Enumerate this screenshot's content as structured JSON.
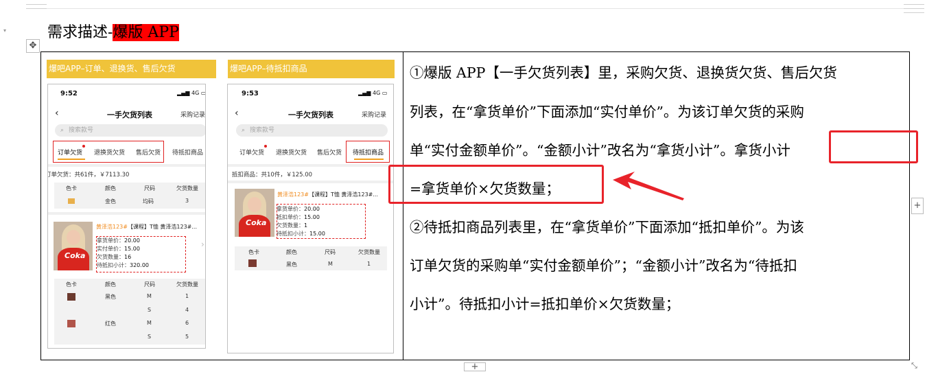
{
  "document": {
    "heading_prefix": "需求描述-",
    "heading_highlight": "爆版 APP",
    "move_handle_icon": "✥",
    "add_column_icon": "+",
    "add_row_icon": "+",
    "resize_icon": "⤡"
  },
  "screen1": {
    "caption": "爆吧APP–订单、退换货、售后欠货",
    "time": "9:52",
    "status": "4G",
    "back_icon": "‹",
    "title": "一手欠货列表",
    "link": "采购记录",
    "search_placeholder": "搜索款号",
    "search_icon": "⌕",
    "tabs": [
      "订单欠货",
      "退换货欠货",
      "售后欠货",
      "待抵扣商品"
    ],
    "summary": "订单欠货：共61件，￥7113.30",
    "table1": {
      "headers": [
        "色卡",
        "颜色",
        "尺码",
        "欠货数量"
      ],
      "row": {
        "color": "金色",
        "size": "均码",
        "qty": "3"
      }
    },
    "product_name_orange": "黄泽浩123#",
    "product_name_rest": "【课程】T恤 黄泽浩123#...",
    "photo_text": "Coka",
    "details": [
      {
        "label": "拿货单价：",
        "value": "20.00"
      },
      {
        "label": "实付单价：",
        "value": "15.00"
      },
      {
        "label": "欠货数量：",
        "value": "16"
      },
      {
        "label": "待抵扣小计：",
        "value": "320.00"
      }
    ],
    "chevron_icon": "›",
    "table2": {
      "headers": [
        "色卡",
        "颜色",
        "尺码",
        "欠货数量"
      ],
      "rows": [
        {
          "color": "黑色",
          "size": "M",
          "qty": "1"
        },
        {
          "color": "",
          "size": "S",
          "qty": "4"
        },
        {
          "color": "红色",
          "size": "M",
          "qty": "6"
        },
        {
          "color": "",
          "size": "S",
          "qty": "5"
        }
      ]
    }
  },
  "screen2": {
    "caption": "爆吧APP–待抵扣商品",
    "time": "9:53",
    "status": "4G",
    "back_icon": "‹",
    "title": "一手欠货列表",
    "link": "采购记录",
    "search_placeholder": "搜索款号",
    "search_icon": "⌕",
    "tabs": [
      "订单欠货",
      "退换货欠货",
      "售后欠货",
      "待抵扣商品"
    ],
    "summary": "抵扣商品：共10件，￥125.00",
    "product_name_orange": "黄泽浩123#",
    "product_name_rest": "【课程】T恤 黄泽浩123#...",
    "photo_text": "Coka",
    "details": [
      {
        "label": "拿货单价：",
        "value": "20.00"
      },
      {
        "label": "抵扣单价：",
        "value": "15.00"
      },
      {
        "label": "欠货数量：",
        "value": "1"
      },
      {
        "label": "待抵扣小计：",
        "value": "15.00"
      }
    ],
    "table": {
      "headers": [
        "色卡",
        "颜色",
        "尺码",
        "欠货数量"
      ],
      "row": {
        "color": "黑色",
        "size": "M",
        "qty": "1"
      }
    }
  },
  "text": {
    "line1": "①爆版 APP【一手欠货列表】里，采购欠货、退换货欠货、售后欠货",
    "line2": "列表，在“拿货单价”下面添加“实付单价”。为该订单欠货的采购",
    "line3": "单“实付金额单价”。“金额小计”改名为“拿货小计”。拿货小计",
    "line4": "=拿货单价×欠货数量；",
    "line5": "②待抵扣商品列表里，在“拿货单价”下面添加“抵扣单价”。为该",
    "line6": "订单欠货的采购单“实付金额单价”；“金额小计”改名为“待抵扣",
    "line7": "小计”。待抵扣小计=抵扣单价×欠货数量；"
  },
  "colors": {
    "highlight": "#ff0000",
    "caption_bg": "#f0c33a",
    "annotation": "#e8232a",
    "price_orange": "#f08a1c"
  }
}
